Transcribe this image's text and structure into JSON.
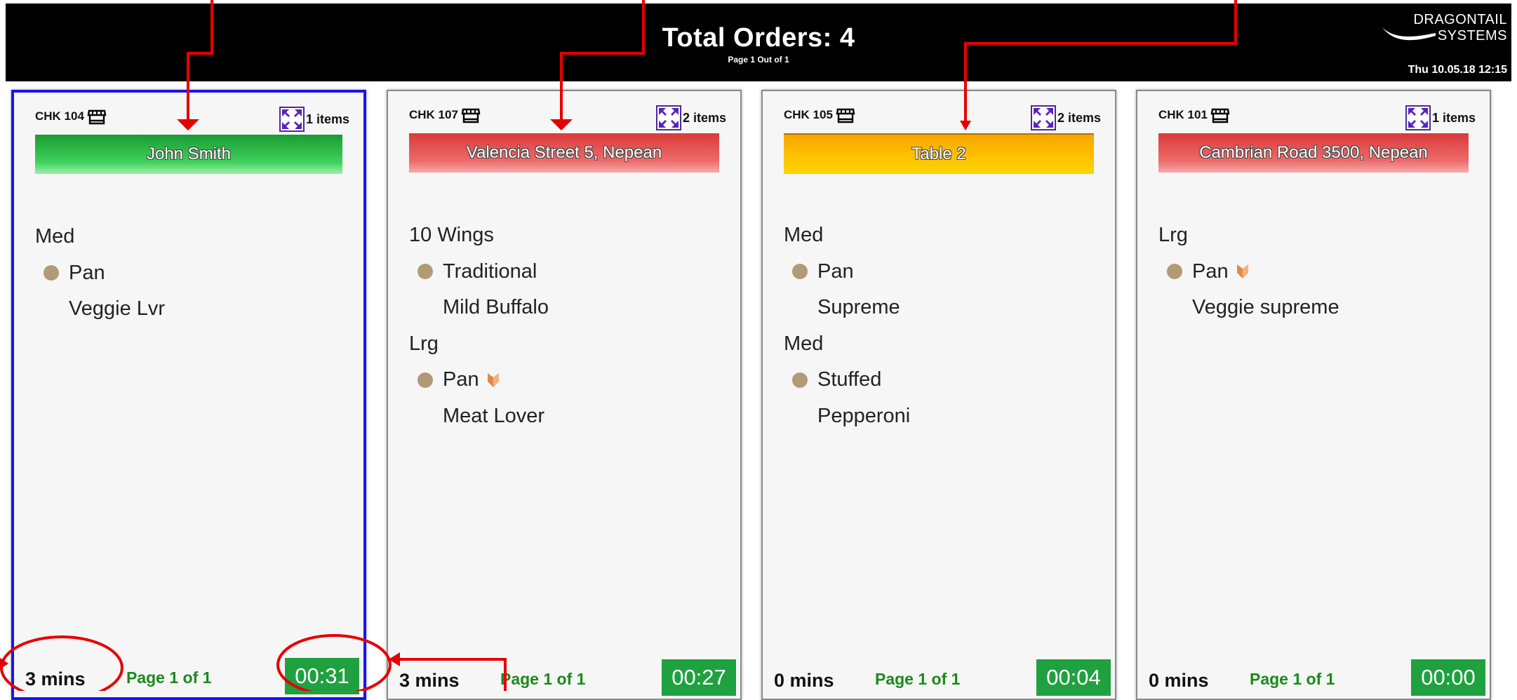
{
  "header": {
    "title": "Total Orders: 4",
    "subtitle": "Page 1 Out of 1",
    "brand_line1": "DRAGONTAIL",
    "brand_line2": "SYSTEMS",
    "datetime": "Thu 10.05.18 12:15"
  },
  "icons": {
    "store": "store-icon",
    "expand": "expand-arrows-icon",
    "half": "half-pizza-icon",
    "bullet": "topping-dot-icon"
  },
  "colors": {
    "header_bg": "#000000",
    "selected_border": "#1a14ee",
    "banner_green": "#3fd15a",
    "banner_red": "#ee6a6a",
    "banner_yellow": "#ffc400",
    "timer_bg": "#1fa140",
    "page_text": "#1b8a1b",
    "annotation": "#e60000",
    "dot": "#b19a75",
    "half_icon": "#e08a4a"
  },
  "tickets": [
    {
      "chk": "CHK 104",
      "items": "1 items",
      "banner": "John Smith",
      "lines": [
        {
          "text": "Med"
        },
        {
          "text": "Pan"
        },
        {
          "text": "Veggie Lvr"
        }
      ],
      "mins": "3 mins",
      "page": "Page 1 of 1",
      "timer": "00:31"
    },
    {
      "chk": "CHK 107",
      "items": "2 items",
      "banner": "Valencia Street 5, Nepean",
      "lines": [
        {
          "text": "10 Wings"
        },
        {
          "text": "Traditional"
        },
        {
          "text": "Mild Buffalo"
        },
        {
          "text": "Lrg"
        },
        {
          "text": "Pan"
        },
        {
          "text": "Meat Lover"
        }
      ],
      "mins": "3 mins",
      "page": "Page 1 of 1",
      "timer": "00:27"
    },
    {
      "chk": "CHK 105",
      "items": "2 items",
      "banner": "Table 2",
      "lines": [
        {
          "text": "Med"
        },
        {
          "text": "Pan"
        },
        {
          "text": "Supreme"
        },
        {
          "text": "Med"
        },
        {
          "text": "Stuffed"
        },
        {
          "text": "Pepperoni"
        }
      ],
      "mins": "0 mins",
      "page": "Page 1 of 1",
      "timer": "00:04"
    },
    {
      "chk": "CHK 101",
      "items": "1 items",
      "banner": "Cambrian Road 3500, Nepean",
      "lines": [
        {
          "text": "Lrg"
        },
        {
          "text": "Pan"
        },
        {
          "text": "Veggie supreme"
        }
      ],
      "mins": "0 mins",
      "page": "Page 1 of 1",
      "timer": "00:00"
    }
  ]
}
